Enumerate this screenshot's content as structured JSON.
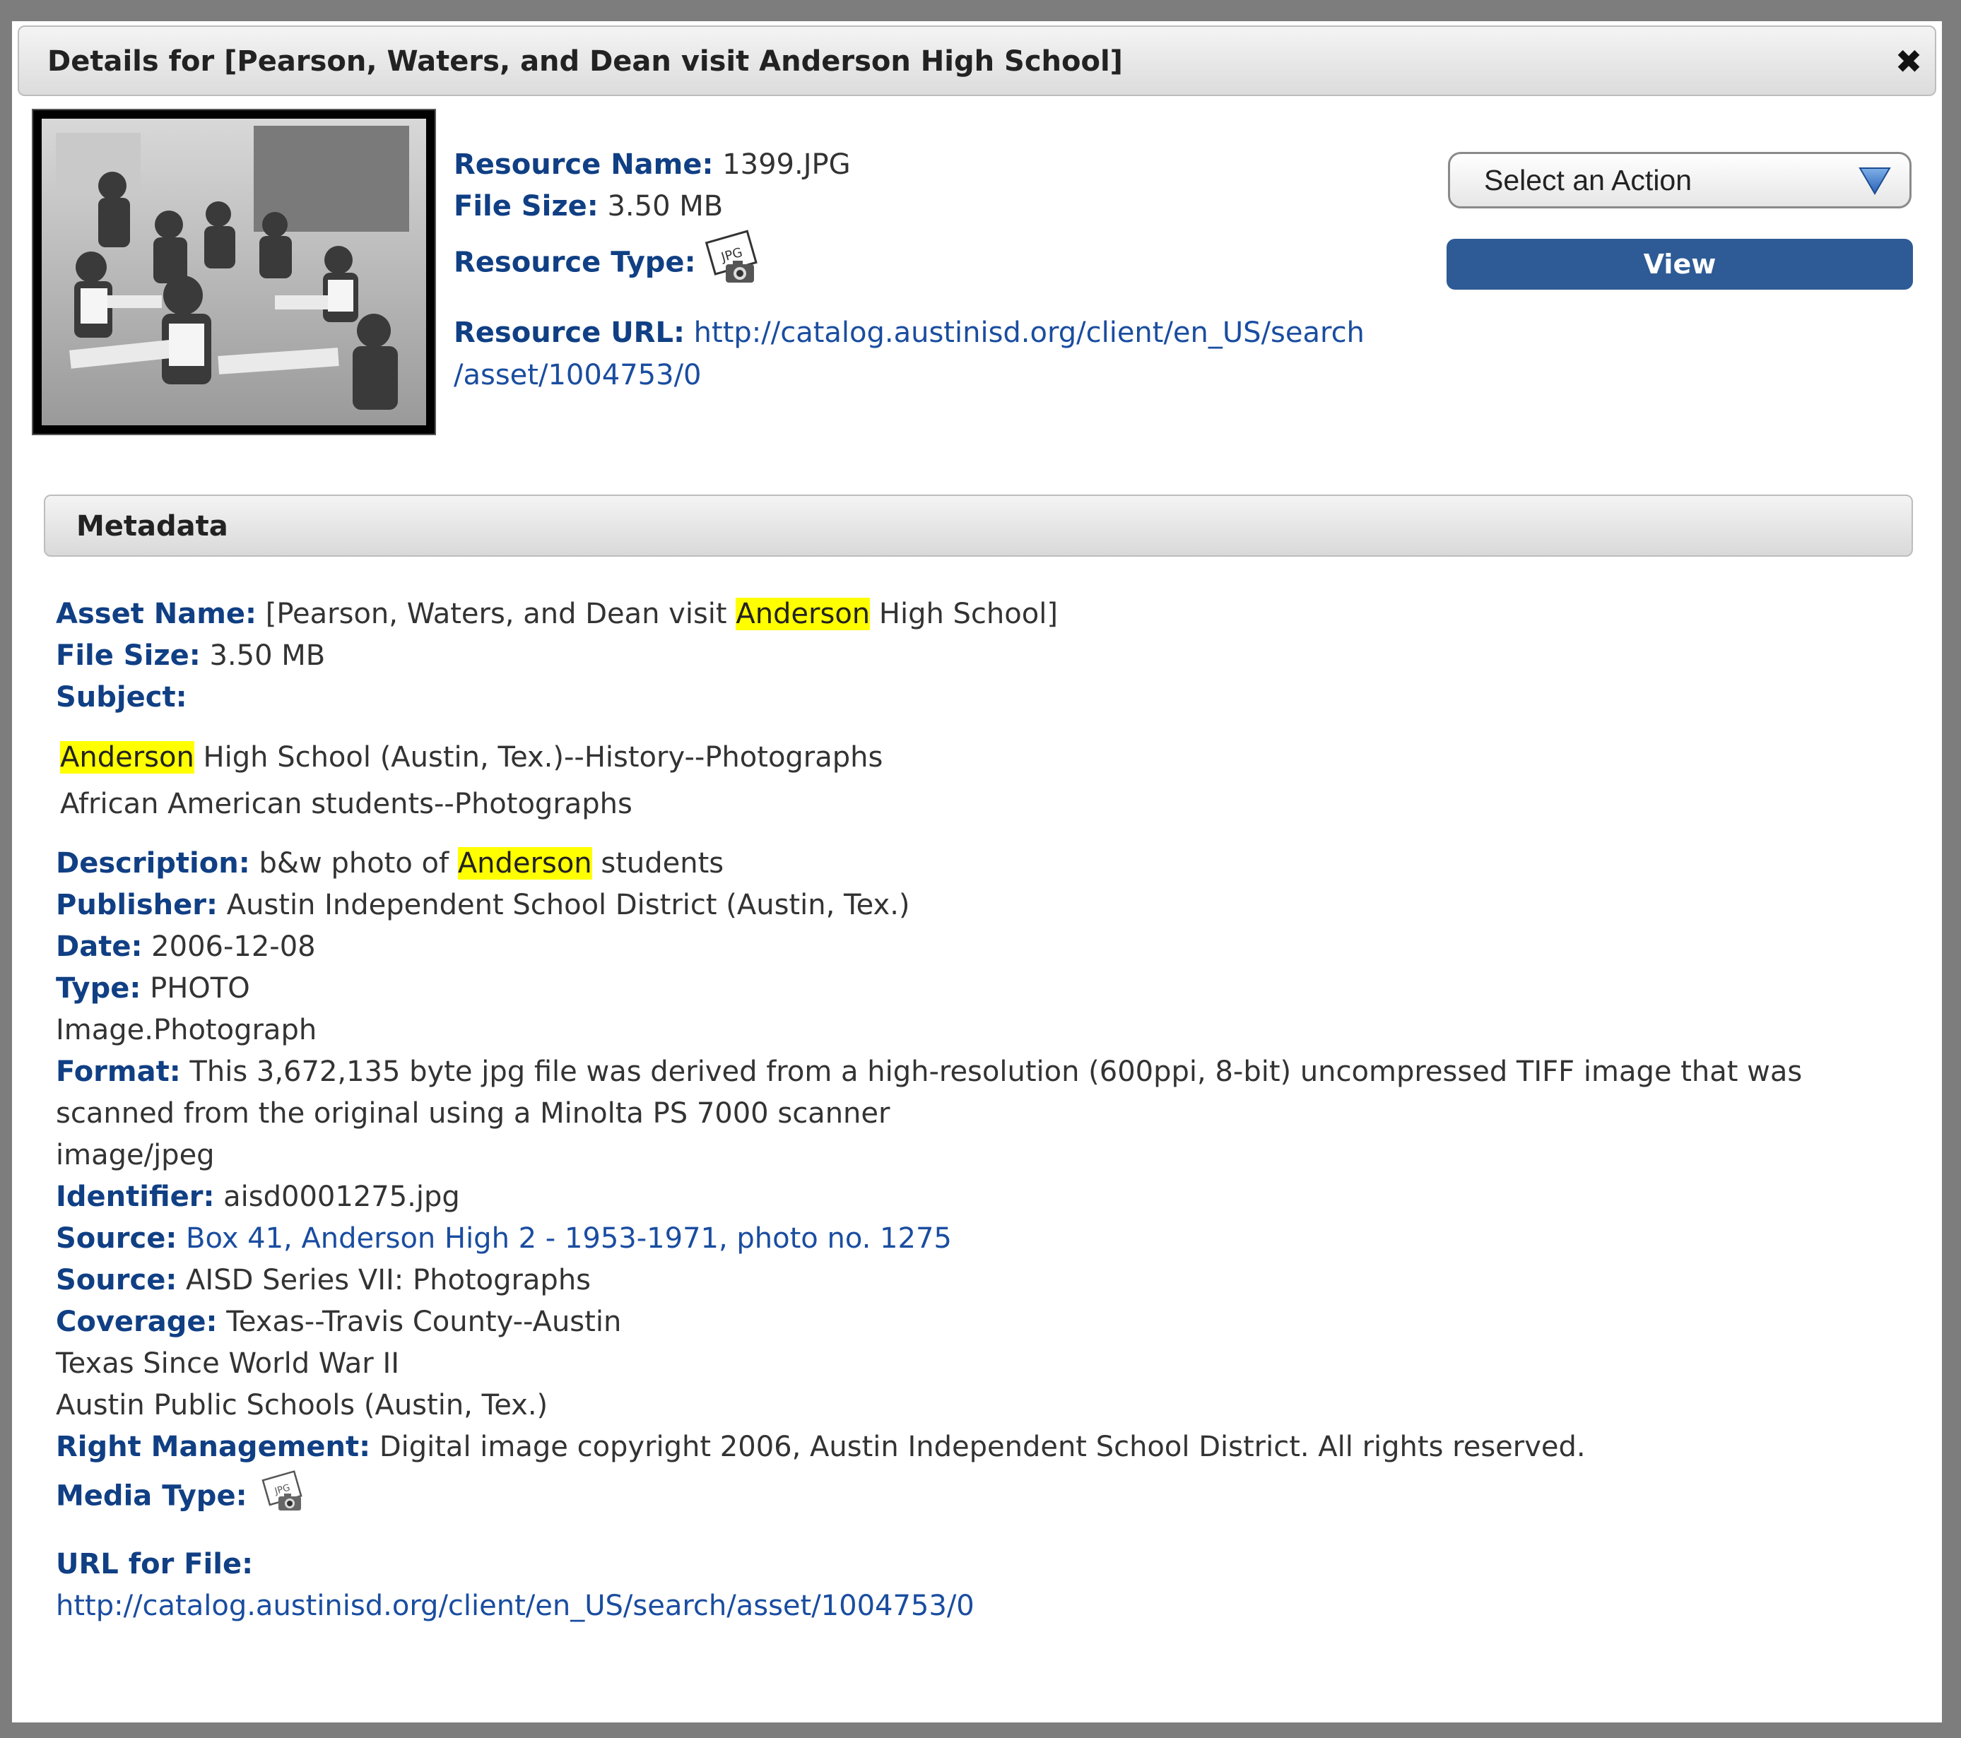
{
  "dialog": {
    "title": "Details for [Pearson, Waters, and Dean visit Anderson High School]",
    "close_glyph": "✖"
  },
  "resource": {
    "name_label": "Resource Name:",
    "name_value": "1399.JPG",
    "size_label": "File Size:",
    "size_value": "3.50 MB",
    "type_label": "Resource Type:",
    "type_icon": "jpg-photo-icon",
    "type_icon_text": "JPG",
    "url_label": "Resource URL:",
    "url_value_line1": "http://catalog.austinisd.org/client/en_US/search",
    "url_value_line2": "/asset/1004753/0"
  },
  "actions": {
    "select_label": "Select an Action",
    "select_icon": "chevron-down-icon",
    "view_label": "View",
    "accent_color": "#2e5b95"
  },
  "metadata": {
    "header": "Metadata",
    "asset_name_label": "Asset Name:",
    "asset_name_before": "[Pearson, Waters, and Dean visit",
    "asset_name_highlight": "Anderson",
    "asset_name_after": "High School]",
    "file_size_label": "File Size:",
    "file_size_value": "3.50 MB",
    "subject_label": "Subject:",
    "subject_1_highlight": "Anderson",
    "subject_1_rest": "High School (Austin, Tex.)--History--Photographs",
    "subject_2": "African American students--Photographs",
    "description_label": "Description:",
    "description_before": "b&w photo of",
    "description_highlight": "Anderson",
    "description_after": "students",
    "publisher_label": "Publisher:",
    "publisher_value": "Austin Independent School District (Austin, Tex.)",
    "date_label": "Date:",
    "date_value": "2006-12-08",
    "type_label": "Type:",
    "type_value": "PHOTO",
    "type_value_2": "Image.Photograph",
    "format_label": "Format:",
    "format_value_line1": "This 3,672,135 byte jpg file was derived from a high-resolution (600ppi, 8-bit) uncompressed TIFF image that was",
    "format_value_line2": "scanned from the original using a Minolta PS 7000 scanner",
    "format_value_2": "image/jpeg",
    "identifier_label": "Identifier:",
    "identifier_value": "aisd0001275.jpg",
    "source_1_label": "Source:",
    "source_1_value": "Box 41, Anderson High 2 - 1953-1971, photo no. 1275",
    "source_2_label": "Source:",
    "source_2_value": "AISD Series VII: Photographs",
    "coverage_label": "Coverage:",
    "coverage_value": "Texas--Travis County--Austin",
    "coverage_value_2": "Texas Since World War II",
    "coverage_value_3": "Austin Public Schools (Austin, Tex.)",
    "rights_label": "Right Management:",
    "rights_value": "Digital image copyright 2006, Austin Independent School District. All rights reserved.",
    "media_type_label": "Media Type:",
    "media_type_icon": "jpg-photo-icon",
    "url_file_label": "URL for File:",
    "url_file_value": "http://catalog.austinisd.org/client/en_US/search/asset/1004753/0",
    "label_color": "#103f84",
    "link_color": "#1a4da0",
    "highlight_color": "#ffff00"
  }
}
